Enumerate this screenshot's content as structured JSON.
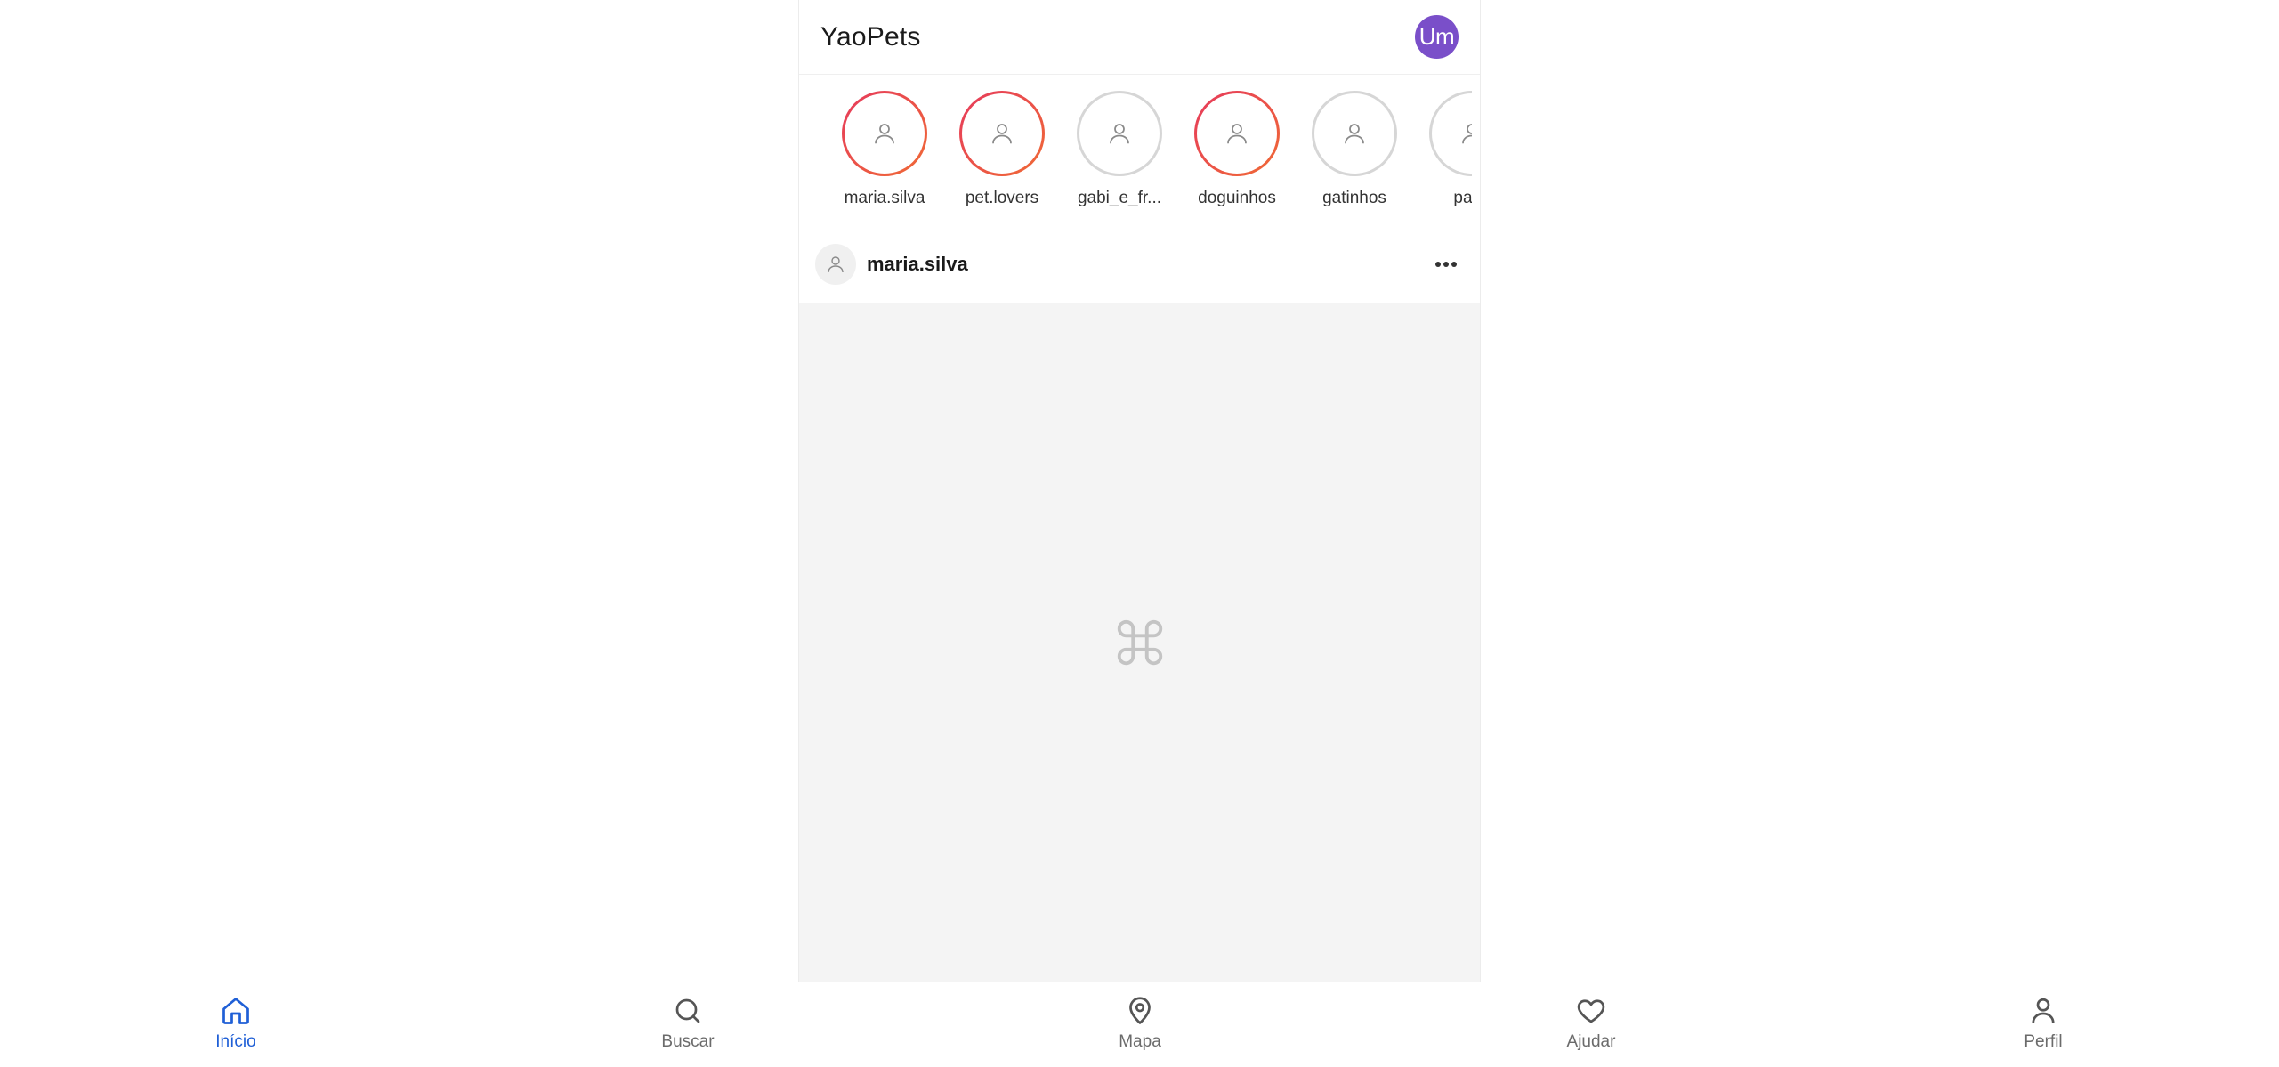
{
  "app": {
    "title": "YaoPets",
    "avatar_initials": "Um",
    "avatar_color": "#7a4fc9"
  },
  "stories": [
    {
      "username": "maria.silva",
      "state": "active"
    },
    {
      "username": "pet.lovers",
      "state": "active"
    },
    {
      "username": "gabi_e_fr...",
      "state": "seen"
    },
    {
      "username": "doguinhos",
      "state": "active"
    },
    {
      "username": "gatinhos",
      "state": "seen"
    },
    {
      "username": "patin",
      "state": "seen"
    }
  ],
  "post": {
    "username": "maria.silva",
    "media_icon": "command-placeholder-icon"
  },
  "nav": {
    "items": [
      {
        "label": "Início",
        "icon": "home-icon",
        "active": true
      },
      {
        "label": "Buscar",
        "icon": "search-icon",
        "active": false
      },
      {
        "label": "Mapa",
        "icon": "map-pin-icon",
        "active": false
      },
      {
        "label": "Ajudar",
        "icon": "heart-icon",
        "active": false
      },
      {
        "label": "Perfil",
        "icon": "user-icon",
        "active": false
      }
    ]
  },
  "colors": {
    "accent": "#1f5fd6",
    "story_ring_start": "#e63a5c",
    "story_ring_end": "#f06a35",
    "story_ring_seen": "#d6d6d6"
  }
}
